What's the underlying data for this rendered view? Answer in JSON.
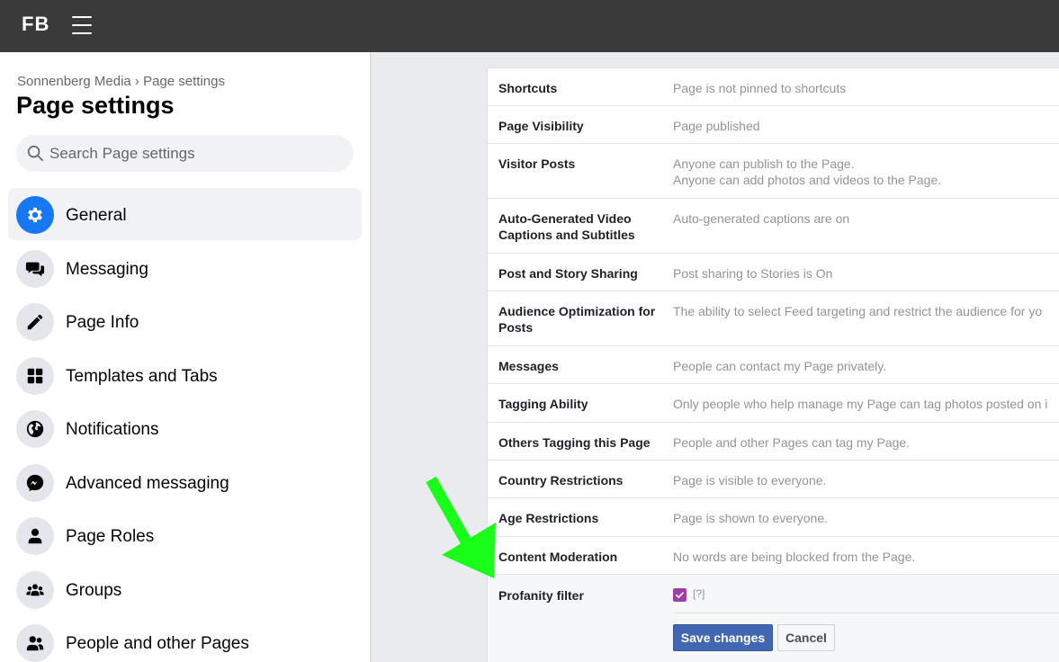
{
  "topbar": {
    "logo": "FB",
    "menu_icon": "hamburger-icon"
  },
  "sidebar": {
    "breadcrumb": "Sonnenberg Media › Page settings",
    "title": "Page settings",
    "search_placeholder": "Search Page settings",
    "items": [
      {
        "label": "General",
        "icon": "gear-icon",
        "active": true
      },
      {
        "label": "Messaging",
        "icon": "chat-bubbles-icon"
      },
      {
        "label": "Page Info",
        "icon": "pencil-icon"
      },
      {
        "label": "Templates and Tabs",
        "icon": "grid-icon"
      },
      {
        "label": "Notifications",
        "icon": "globe-icon"
      },
      {
        "label": "Advanced messaging",
        "icon": "messenger-icon"
      },
      {
        "label": "Page Roles",
        "icon": "person-icon"
      },
      {
        "label": "Groups",
        "icon": "group-icon"
      },
      {
        "label": "People and other Pages",
        "icon": "people-icon"
      }
    ]
  },
  "settings": {
    "rows": [
      {
        "label": "Shortcuts",
        "value": "Page is not pinned to shortcuts"
      },
      {
        "label": "Page Visibility",
        "value": "Page published"
      },
      {
        "label": "Visitor Posts",
        "value_lines": [
          "Anyone can publish to the Page.",
          "Anyone can add photos and videos to the Page."
        ]
      },
      {
        "label_lines": [
          "Auto-Generated Video",
          "Captions and Subtitles"
        ],
        "value": "Auto-generated captions are on"
      },
      {
        "label": "Post and Story Sharing",
        "value": "Post sharing to Stories is On"
      },
      {
        "label_lines": [
          "Audience Optimization for",
          "Posts"
        ],
        "value": "The ability to select Feed targeting and restrict the audience for yo"
      },
      {
        "label": "Messages",
        "value": "People can contact my Page privately."
      },
      {
        "label": "Tagging Ability",
        "value": "Only people who help manage my Page can tag photos posted on i"
      },
      {
        "label": "Others Tagging this Page",
        "value": "People and other Pages can tag my Page."
      },
      {
        "label": "Country Restrictions",
        "value": "Page is visible to everyone."
      },
      {
        "label": "Age Restrictions",
        "value": "Page is shown to everyone."
      },
      {
        "label": "Content Moderation",
        "value": "No words are being blocked from the Page."
      }
    ],
    "profanity": {
      "label": "Profanity filter",
      "checked": true,
      "help": "[?]",
      "save_label": "Save changes",
      "cancel_label": "Cancel"
    }
  },
  "colors": {
    "accent": "#1877f2",
    "save_button": "#4267b2",
    "checkbox": "#9c3fa6",
    "arrow": "#19ff19"
  }
}
